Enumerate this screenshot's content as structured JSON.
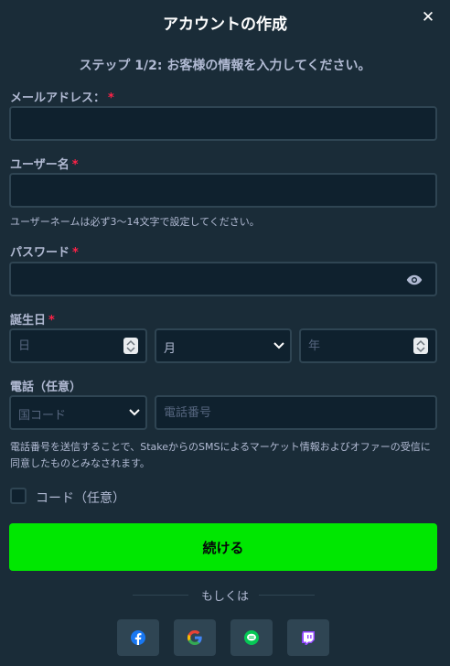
{
  "modal": {
    "title": "アカウントの作成",
    "close_symbol": "✕",
    "step": "ステップ 1/2: お客様の情報を入力してください。"
  },
  "fields": {
    "email": {
      "label": "メールアドレス：",
      "required_mark": "*",
      "value": ""
    },
    "username": {
      "label": "ユーザー名",
      "required_mark": "*",
      "value": "",
      "hint": "ユーザーネームは必ず3〜14文字で設定してください。"
    },
    "password": {
      "label": "パスワード",
      "required_mark": "*",
      "value": ""
    },
    "birthdate": {
      "label": "誕生日",
      "required_mark": "*",
      "day_placeholder": "日",
      "month_value": "月",
      "year_placeholder": "年"
    },
    "phone": {
      "label": "電話（任意）",
      "country_code_value": "国コード",
      "number_placeholder": "電話番号",
      "consent": "電話番号を送信することで、StakeからのSMSによるマーケット情報およびオファーの受信に同意したものとみなされます。"
    }
  },
  "code": {
    "label": "コード（任意）",
    "checked": false
  },
  "continue_label": "続ける",
  "divider_text": "もしくは",
  "social": [
    {
      "name": "facebook-icon",
      "color": "#1877f2"
    },
    {
      "name": "google-icon",
      "color": "#ea4335"
    },
    {
      "name": "line-icon",
      "color": "#06c755"
    },
    {
      "name": "twitch-icon",
      "color": "#9146ff"
    }
  ],
  "colors": {
    "background": "#1a2c38",
    "input_bg": "#0f212e",
    "input_border": "#2f4553",
    "accent_green": "#00e701",
    "required": "#fe2247"
  }
}
